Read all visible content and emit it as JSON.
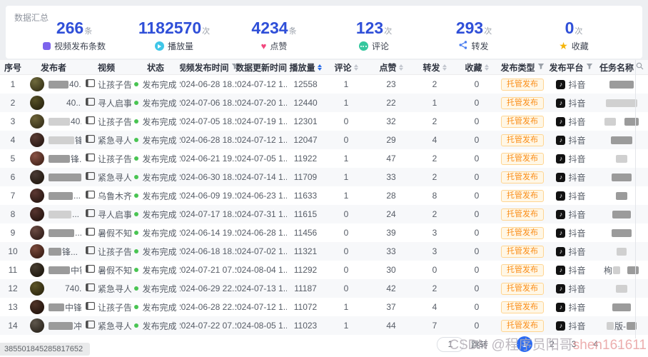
{
  "page": {
    "summary_title": "数据汇总",
    "status_bar": "385501845285817652",
    "watermark": {
      "prefix": "CSDN @程序员阳哥",
      "suffix": "shen161611"
    }
  },
  "stats": [
    {
      "key": "video_count",
      "value": "266",
      "unit": "条",
      "label": "视频发布条数",
      "icon": "video-square-icon",
      "color": "#7d64ed"
    },
    {
      "key": "plays",
      "value": "1182570",
      "unit": "次",
      "label": "播放量",
      "icon": "play-icon",
      "color": "#3fc6e8"
    },
    {
      "key": "likes",
      "value": "4234",
      "unit": "条",
      "label": "点赞",
      "icon": "heart-icon",
      "color": "#f2477e"
    },
    {
      "key": "comments",
      "value": "123",
      "unit": "次",
      "label": "评论",
      "icon": "comment-icon",
      "color": "#35c79e"
    },
    {
      "key": "shares",
      "value": "293",
      "unit": "次",
      "label": "转发",
      "icon": "share-icon",
      "color": "#4a7df0"
    },
    {
      "key": "favorites",
      "value": "0",
      "unit": "次",
      "label": "收藏",
      "icon": "star-icon",
      "color": "#f5b50a"
    }
  ],
  "table": {
    "columns": [
      {
        "key": "index",
        "label": "序号",
        "icon": "none"
      },
      {
        "key": "publisher",
        "label": "发布者",
        "icon": "none"
      },
      {
        "key": "video",
        "label": "视频",
        "icon": "none"
      },
      {
        "key": "status",
        "label": "状态",
        "icon": "none"
      },
      {
        "key": "publish_time",
        "label": "视频发布时间",
        "icon": "filter"
      },
      {
        "key": "update_time",
        "label": "数据更新时间",
        "icon": "none"
      },
      {
        "key": "plays",
        "label": "播放量",
        "icon": "sort-active"
      },
      {
        "key": "comments",
        "label": "评论",
        "icon": "sort"
      },
      {
        "key": "likes",
        "label": "点赞",
        "icon": "sort"
      },
      {
        "key": "shares",
        "label": "转发",
        "icon": "sort"
      },
      {
        "key": "favorites",
        "label": "收藏",
        "icon": "sort"
      },
      {
        "key": "publish_type",
        "label": "发布类型",
        "icon": "filter"
      },
      {
        "key": "platform",
        "label": "发布平台",
        "icon": "filter"
      },
      {
        "key": "task",
        "label": "任务名称",
        "icon": "search"
      }
    ],
    "status_text": "发布完成",
    "rows": [
      {
        "idx": "1",
        "avatar": [
          "#6f6a3c",
          "#2a260f"
        ],
        "pub_block": [
          28,
          "d"
        ],
        "pub_frag": "40...",
        "video": "让孩子告...",
        "pt": "2024-06-28 18...",
        "ut": "2024-07-12 1...",
        "plays": "12558",
        "comments": "1",
        "likes": "23",
        "shares": "2",
        "favs": "0",
        "type": "托管发布",
        "platform": "抖音",
        "task": [
          {
            "b": 34,
            "s": "d"
          }
        ]
      },
      {
        "idx": "2",
        "avatar": [
          "#565026",
          "#1f1b0a"
        ],
        "pub_block": [
          24,
          "w"
        ],
        "pub_frag": "40...",
        "video": "寻人启事...",
        "pt": "2024-07-06 18...",
        "ut": "2024-07-20 1...",
        "plays": "12440",
        "comments": "1",
        "likes": "22",
        "shares": "1",
        "favs": "0",
        "type": "托管发布",
        "platform": "抖音",
        "task": [
          {
            "b": 44,
            "s": "l"
          }
        ]
      },
      {
        "idx": "3",
        "avatar": [
          "#6c6238",
          "#2b2512"
        ],
        "pub_block": [
          30,
          "l"
        ],
        "pub_frag": "40...",
        "video": "让孩子告...",
        "pt": "2024-07-05 18...",
        "ut": "2024-07-19 1...",
        "plays": "12301",
        "comments": "0",
        "likes": "32",
        "shares": "2",
        "favs": "0",
        "type": "托管发布",
        "platform": "抖音",
        "task": [
          {
            "b": 16,
            "s": "l"
          },
          {
            "sp": 10
          },
          {
            "b": 20,
            "s": "d"
          }
        ]
      },
      {
        "idx": "4",
        "avatar": [
          "#5a3c34",
          "#1d100c"
        ],
        "pub_block": [
          36,
          "l"
        ],
        "pub_frag": "锋...",
        "video": "紧急寻人...",
        "pt": "2024-06-28 18...",
        "ut": "2024-07-12 1...",
        "plays": "12047",
        "comments": "0",
        "likes": "29",
        "shares": "4",
        "favs": "0",
        "type": "托管发布",
        "platform": "抖音",
        "task": [
          {
            "b": 30,
            "s": "d"
          }
        ]
      },
      {
        "idx": "5",
        "avatar": [
          "#8a5346",
          "#33190f"
        ],
        "pub_block": [
          30,
          "d"
        ],
        "pub_frag": "锋...",
        "video": "让孩子告...",
        "pt": "2024-06-21 19...",
        "ut": "2024-07-05 1...",
        "plays": "11922",
        "comments": "1",
        "likes": "47",
        "shares": "2",
        "favs": "0",
        "type": "托管发布",
        "platform": "抖音",
        "task": [
          {
            "b": 16,
            "s": "l"
          }
        ]
      },
      {
        "idx": "6",
        "avatar": [
          "#4a3a34",
          "#171007"
        ],
        "pub_block": [
          46,
          "d"
        ],
        "pub_frag": "...",
        "video": "紧急寻人...",
        "pt": "2024-06-30 18...",
        "ut": "2024-07-14 1...",
        "plays": "11709",
        "comments": "1",
        "likes": "33",
        "shares": "2",
        "favs": "0",
        "type": "托管发布",
        "platform": "抖音",
        "task": [
          {
            "b": 28,
            "s": "d"
          }
        ]
      },
      {
        "idx": "7",
        "avatar": [
          "#5c3832",
          "#1c0f0a"
        ],
        "pub_block": [
          34,
          "d"
        ],
        "pub_frag": "...",
        "video": "乌鲁木齐...",
        "pt": "2024-06-09 19...",
        "ut": "2024-06-23 1...",
        "plays": "11633",
        "comments": "1",
        "likes": "28",
        "shares": "8",
        "favs": "0",
        "type": "托管发布",
        "platform": "抖音",
        "task": [
          {
            "b": 16,
            "s": "d"
          }
        ]
      },
      {
        "idx": "8",
        "avatar": [
          "#56342e",
          "#1a0d08"
        ],
        "pub_block": [
          32,
          "l"
        ],
        "pub_frag": "...",
        "video": "寻人启事...",
        "pt": "2024-07-17 18...",
        "ut": "2024-07-31 1...",
        "plays": "11615",
        "comments": "0",
        "likes": "24",
        "shares": "2",
        "favs": "0",
        "type": "托管发布",
        "platform": "抖音",
        "task": [
          {
            "b": 26,
            "s": "d"
          }
        ]
      },
      {
        "idx": "9",
        "avatar": [
          "#6a4a42",
          "#241410"
        ],
        "pub_block": [
          36,
          "d"
        ],
        "pub_frag": "...",
        "video": "暑假不知...",
        "pt": "2024-06-14 19...",
        "ut": "2024-06-28 1...",
        "plays": "11456",
        "comments": "0",
        "likes": "39",
        "shares": "3",
        "favs": "0",
        "type": "托管发布",
        "platform": "抖音",
        "task": [
          {
            "b": 28,
            "s": "d"
          }
        ]
      },
      {
        "idx": "10",
        "avatar": [
          "#7a4a3c",
          "#2b130c"
        ],
        "pub_block": [
          18,
          "d"
        ],
        "pub_frag": "锋...",
        "video": "让孩子告...",
        "pt": "2024-06-18 18...",
        "ut": "2024-07-02 1...",
        "plays": "11321",
        "comments": "0",
        "likes": "33",
        "shares": "3",
        "favs": "0",
        "type": "托管发布",
        "platform": "抖音",
        "task": [
          {
            "b": 14,
            "s": "l"
          }
        ]
      },
      {
        "idx": "11",
        "avatar": [
          "#463c30",
          "#140e06"
        ],
        "pub_block": [
          30,
          "d"
        ],
        "pub_frag": "中锋...",
        "video": "暑假不知...",
        "pt": "2024-07-21 07...",
        "ut": "2024-08-04 1...",
        "plays": "11292",
        "comments": "0",
        "likes": "30",
        "shares": "0",
        "favs": "0",
        "type": "托管发布",
        "platform": "抖音",
        "task": [
          {
            "t": "栒"
          },
          {
            "b": 10,
            "s": "l"
          },
          {
            "sp": 8
          },
          {
            "b": 16,
            "s": "d"
          }
        ]
      },
      {
        "idx": "12",
        "avatar": [
          "#5c5428",
          "#221c08"
        ],
        "pub_block": [
          22,
          "w"
        ],
        "pub_frag": "740...",
        "video": "紧急寻人...",
        "pt": "2024-06-29 22...",
        "ut": "2024-07-13 1...",
        "plays": "11187",
        "comments": "0",
        "likes": "42",
        "shares": "2",
        "favs": "0",
        "type": "托管发布",
        "platform": "抖音",
        "task": [
          {
            "b": 16,
            "s": "l"
          }
        ]
      },
      {
        "idx": "13",
        "avatar": [
          "#503428",
          "#170b05"
        ],
        "pub_block": [
          22,
          "d"
        ],
        "pub_frag": "中锋...",
        "video": "让孩子告...",
        "pt": "2024-06-28 22...",
        "ut": "2024-07-12 1...",
        "plays": "11072",
        "comments": "1",
        "likes": "37",
        "shares": "4",
        "favs": "0",
        "type": "托管发布",
        "platform": "抖音",
        "task": [
          {
            "b": 26,
            "s": "d"
          }
        ]
      },
      {
        "idx": "14",
        "avatar": [
          "#5e564c",
          "#1f1a12"
        ],
        "pub_block": [
          34,
          "d"
        ],
        "pub_frag": "冲锋...",
        "video": "紧急寻人...",
        "pt": "2024-07-22 07...",
        "ut": "2024-08-05 1...",
        "plays": "11023",
        "comments": "1",
        "likes": "44",
        "shares": "7",
        "favs": "0",
        "type": "托管发布",
        "platform": "抖音",
        "task": [
          {
            "b": 10,
            "s": "l"
          },
          {
            "t": "版-"
          },
          {
            "b": 14,
            "s": "d"
          }
        ]
      }
    ]
  },
  "pagination": {
    "jump_value": "1",
    "jump_label": "跳转",
    "active_page": "1",
    "pages": [
      "2",
      "3",
      "4"
    ],
    "ellipsis": "..."
  }
}
